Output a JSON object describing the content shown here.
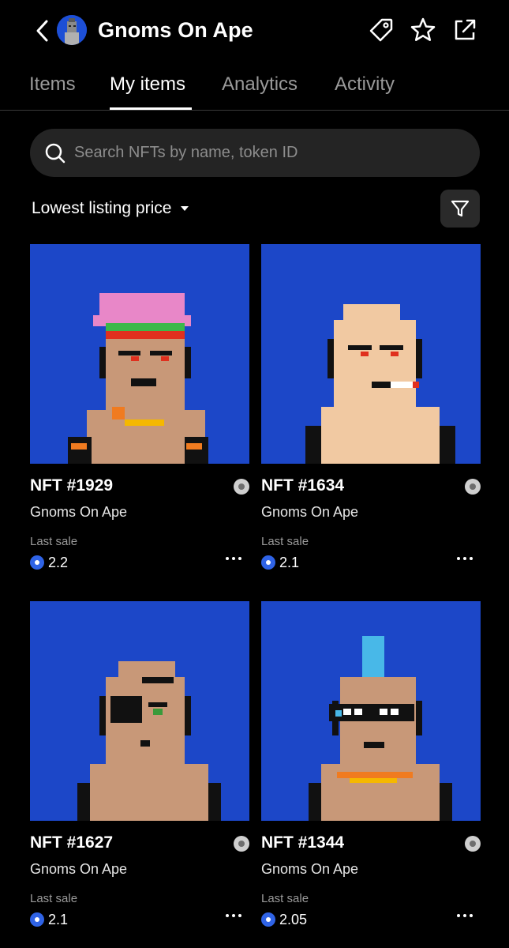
{
  "header": {
    "title": "Gnoms On Ape",
    "icons": [
      "chevron-left-icon",
      "tag-icon",
      "star-icon",
      "external-link-icon"
    ]
  },
  "tabs": [
    {
      "label": "Items",
      "active": false
    },
    {
      "label": "My items",
      "active": true
    },
    {
      "label": "Analytics",
      "active": false
    },
    {
      "label": "Activity",
      "active": false
    }
  ],
  "search": {
    "placeholder": "Search NFTs by name, token ID",
    "value": ""
  },
  "sort": {
    "label": "Lowest listing price"
  },
  "colors": {
    "background": "#000000",
    "card_bg": "#1c47c8",
    "search_bg": "#242424",
    "ape_coin": "#2f63e6"
  },
  "cards": [
    {
      "name": "NFT #1929",
      "collection": "Gnoms On Ape",
      "sale_label": "Last sale",
      "sale_value": "2.2"
    },
    {
      "name": "NFT #1634",
      "collection": "Gnoms On Ape",
      "sale_label": "Last sale",
      "sale_value": "2.1"
    },
    {
      "name": "NFT #1627",
      "collection": "Gnoms On Ape",
      "sale_label": "Last sale",
      "sale_value": "2.1"
    },
    {
      "name": "NFT #1344",
      "collection": "Gnoms On Ape",
      "sale_label": "Last sale",
      "sale_value": "2.05"
    }
  ]
}
